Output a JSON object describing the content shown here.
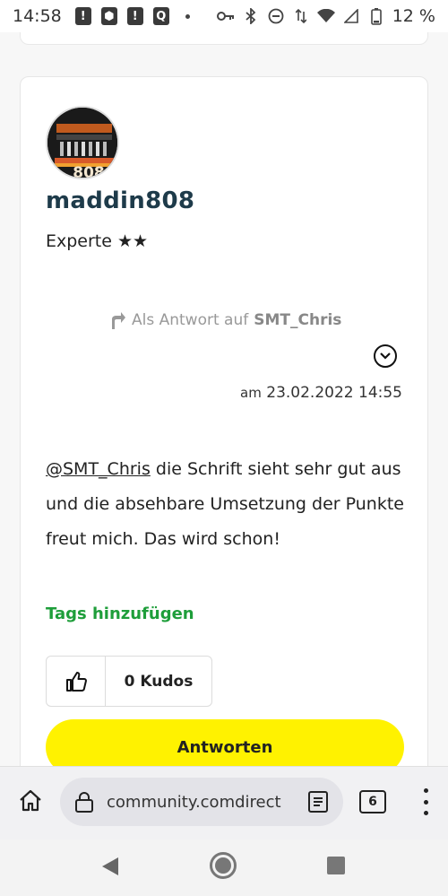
{
  "status_bar": {
    "time": "14:58",
    "battery": "12 %"
  },
  "post": {
    "username": "maddin808",
    "avatar_text": "808",
    "rank": "Experte ★★",
    "reply_to_prefix": "Als Antwort auf",
    "reply_to_user": "SMT_Chris",
    "date_prefix": "am",
    "date": "23.02.2022 14:55",
    "mention": "@SMT_Chris",
    "body": " die Schrift sieht sehr gut aus und die absehbare Umsetzung der Punkte freut mich. Das wird schon!",
    "tags_link": "Tags hinzufügen",
    "kudos": "0 Kudos",
    "reply_button": "Antworten"
  },
  "browser": {
    "url": "community.comdirect",
    "tab_count": "6"
  },
  "colors": {
    "accent_yellow": "#fff200",
    "tags_green": "#1e9e3a",
    "username_navy": "#1e3b4a"
  }
}
